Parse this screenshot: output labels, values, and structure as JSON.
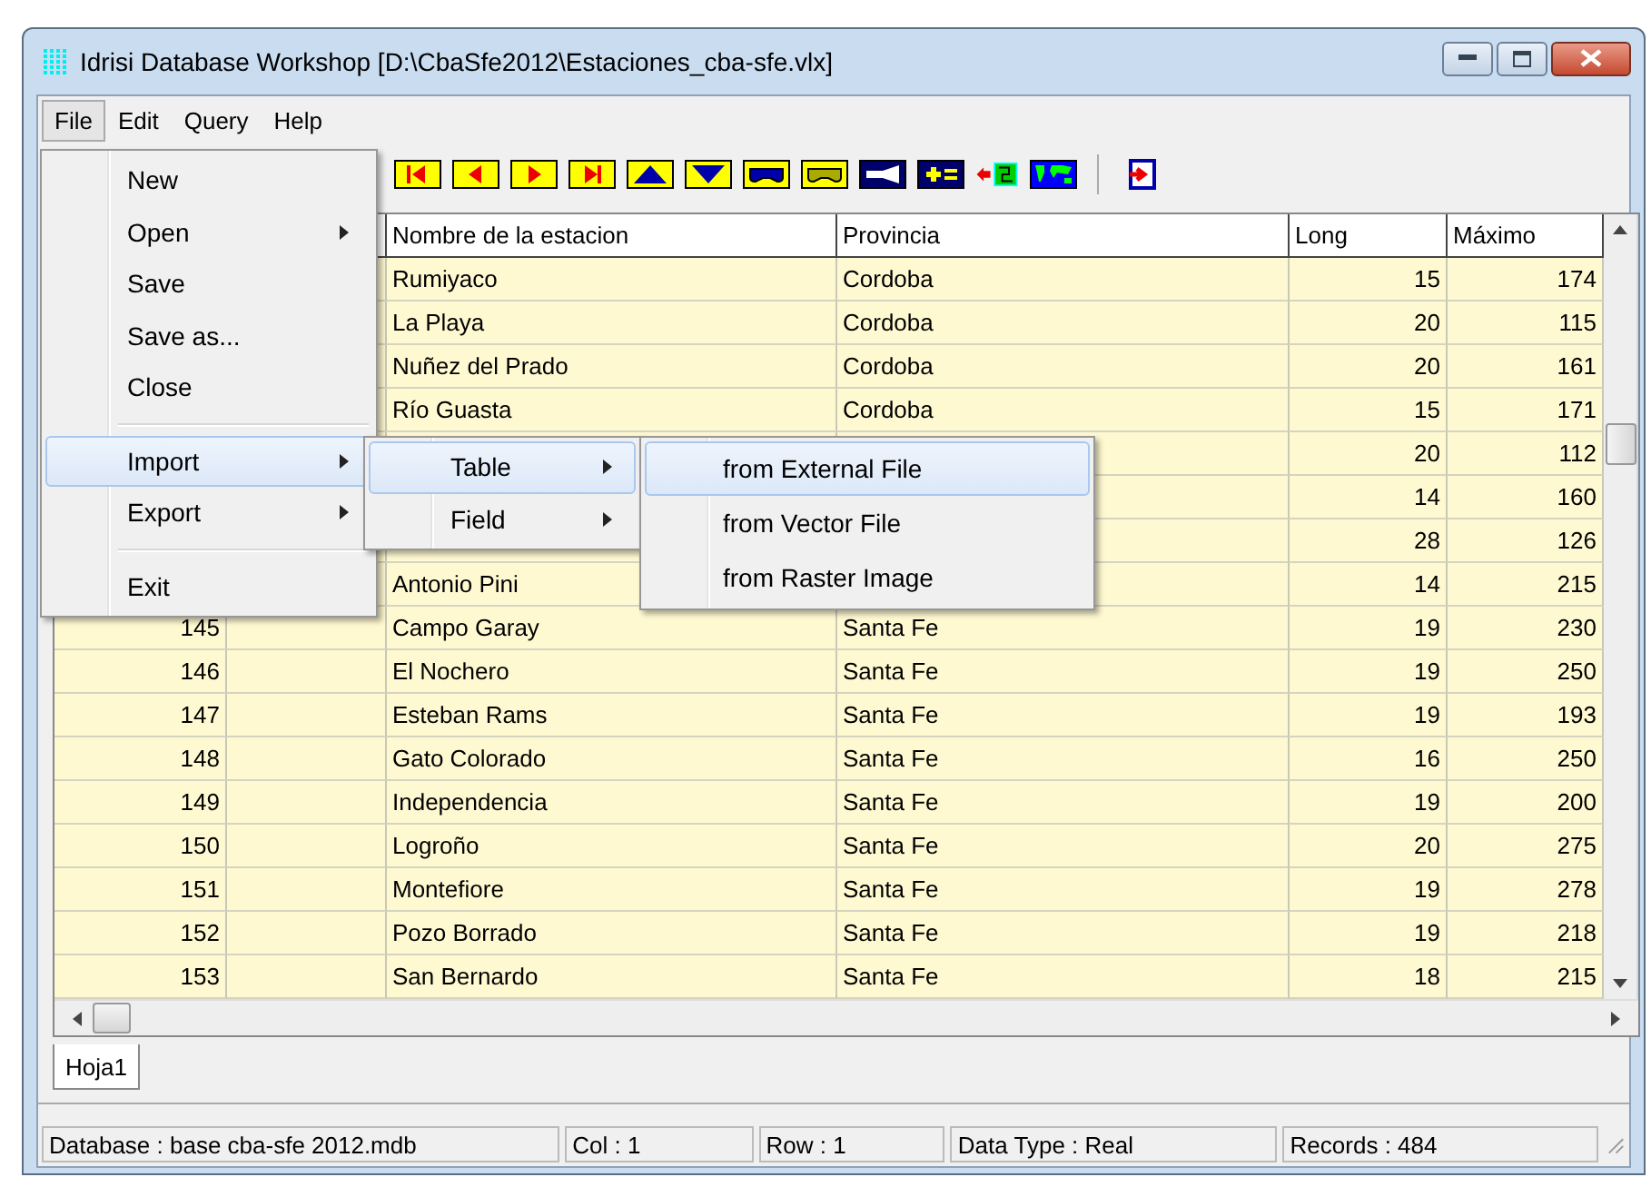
{
  "window": {
    "title": "Idrisi Database Workshop [D:\\CbaSfe2012\\Estaciones_cba-sfe.vlx]"
  },
  "menubar": [
    {
      "label": "File",
      "selected": true
    },
    {
      "label": "Edit",
      "selected": false
    },
    {
      "label": "Query",
      "selected": false
    },
    {
      "label": "Help",
      "selected": false
    }
  ],
  "toolbar": [
    {
      "kind": "first"
    },
    {
      "kind": "prev"
    },
    {
      "kind": "next"
    },
    {
      "kind": "last"
    },
    {
      "kind": "up"
    },
    {
      "kind": "down"
    },
    {
      "kind": "mask-blue"
    },
    {
      "kind": "mask-olive"
    },
    {
      "kind": "torch"
    },
    {
      "kind": "calc"
    },
    {
      "kind": "import-map"
    },
    {
      "kind": "world"
    },
    {
      "kind": "sep"
    },
    {
      "kind": "exit"
    }
  ],
  "table": {
    "columns": [
      "Nombre de la estacion",
      "Provincia",
      "Long",
      "Máximo"
    ],
    "rows": [
      {
        "name": "Rumiyaco",
        "provincia": "Cordoba",
        "long": "15",
        "max": "174"
      },
      {
        "name": "La Playa",
        "provincia": "Cordoba",
        "long": "20",
        "max": "115"
      },
      {
        "name": "Nuñez del Prado",
        "provincia": "Cordoba",
        "long": "20",
        "max": "161"
      },
      {
        "name": "Río Guasta",
        "provincia": "Cordoba",
        "long": "15",
        "max": "171"
      },
      {
        "long": "20",
        "max": "112"
      },
      {
        "long": "14",
        "max": "160"
      },
      {
        "long": "28",
        "max": "126"
      },
      {
        "name": "Antonio Pini",
        "long": "14",
        "max": "215"
      },
      {
        "id": "145",
        "name": "Campo Garay",
        "provincia": "Santa Fe",
        "long": "19",
        "max": "230"
      },
      {
        "id": "146",
        "name": "El Nochero",
        "provincia": "Santa Fe",
        "long": "19",
        "max": "250"
      },
      {
        "id": "147",
        "name": "Esteban Rams",
        "provincia": "Santa Fe",
        "long": "19",
        "max": "193"
      },
      {
        "id": "148",
        "name": "Gato Colorado",
        "provincia": "Santa Fe",
        "long": "16",
        "max": "250"
      },
      {
        "id": "149",
        "name": "Independencia",
        "provincia": "Santa Fe",
        "long": "19",
        "max": "200"
      },
      {
        "id": "150",
        "name": "Logroño",
        "provincia": "Santa Fe",
        "long": "20",
        "max": "275"
      },
      {
        "id": "151",
        "name": "Montefiore",
        "provincia": "Santa Fe",
        "long": "19",
        "max": "278"
      },
      {
        "id": "152",
        "name": "Pozo Borrado",
        "provincia": "Santa Fe",
        "long": "19",
        "max": "218"
      },
      {
        "id": "153",
        "name": "San Bernardo",
        "provincia": "Santa Fe",
        "long": "18",
        "max": "215"
      }
    ]
  },
  "sheet_tabs": [
    {
      "label": "Hoja1",
      "selected": true
    }
  ],
  "status_bar": [
    "Database : base cba-sfe 2012.mdb",
    "Col : 1",
    "Row : 1",
    "Data Type : Real",
    "Records : 484"
  ],
  "file_menu": [
    {
      "kind": "item",
      "label": "New",
      "selected": false,
      "has_submenu": false
    },
    {
      "kind": "item",
      "label": "Open",
      "selected": false,
      "has_submenu": true
    },
    {
      "kind": "item",
      "label": "Save",
      "selected": false,
      "has_submenu": false
    },
    {
      "kind": "item",
      "label": "Save as...",
      "selected": false,
      "has_submenu": false
    },
    {
      "kind": "item",
      "label": "Close",
      "selected": false,
      "has_submenu": false
    },
    {
      "kind": "separator"
    },
    {
      "kind": "item",
      "label": "Import",
      "selected": true,
      "has_submenu": true
    },
    {
      "kind": "item",
      "label": "Export",
      "selected": false,
      "has_submenu": true
    },
    {
      "kind": "separator"
    },
    {
      "kind": "item",
      "label": "Exit",
      "selected": false,
      "has_submenu": false
    }
  ],
  "import_menu": [
    {
      "kind": "item",
      "label": "Table",
      "selected": true,
      "has_submenu": true
    },
    {
      "kind": "item",
      "label": "Field",
      "selected": false,
      "has_submenu": true
    }
  ],
  "table_menu": [
    {
      "kind": "item",
      "label": "from External File",
      "selected": true,
      "has_submenu": false
    },
    {
      "kind": "item",
      "label": "from Vector File",
      "selected": false,
      "has_submenu": false
    },
    {
      "kind": "item",
      "label": "from Raster Image",
      "selected": false,
      "has_submenu": false
    }
  ]
}
